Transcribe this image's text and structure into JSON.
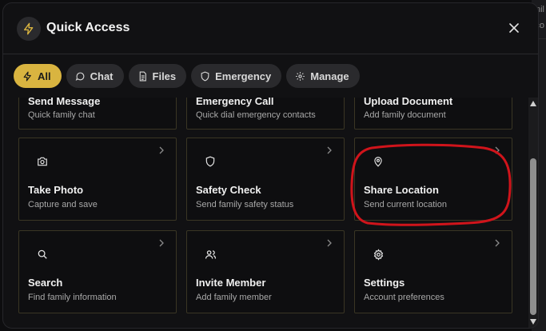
{
  "header": {
    "title": "Quick Access",
    "close_label": "×"
  },
  "tabs": [
    {
      "label": "All",
      "icon": "lightning-icon",
      "active": true
    },
    {
      "label": "Chat",
      "icon": "chat-bubble-icon",
      "active": false
    },
    {
      "label": "Files",
      "icon": "document-icon",
      "active": false
    },
    {
      "label": "Emergency",
      "icon": "shield-icon",
      "active": false
    },
    {
      "label": "Manage",
      "icon": "gear-icon",
      "active": false
    }
  ],
  "cards": [
    {
      "title": "Send Message",
      "subtitle": "Quick family chat",
      "icon": "chat-icon"
    },
    {
      "title": "Emergency Call",
      "subtitle": "Quick dial emergency contacts",
      "icon": "phone-icon"
    },
    {
      "title": "Upload Document",
      "subtitle": "Add family document",
      "icon": "upload-icon"
    },
    {
      "title": "Take Photo",
      "subtitle": "Capture and save",
      "icon": "camera-icon"
    },
    {
      "title": "Safety Check",
      "subtitle": "Send family safety status",
      "icon": "shield-icon"
    },
    {
      "title": "Share Location",
      "subtitle": "Send current location",
      "icon": "location-pin-icon"
    },
    {
      "title": "Search",
      "subtitle": "Find family information",
      "icon": "search-icon"
    },
    {
      "title": "Invite Member",
      "subtitle": "Add family member",
      "icon": "users-icon"
    },
    {
      "title": "Settings",
      "subtitle": "Account preferences",
      "icon": "gear-icon"
    }
  ],
  "background": {
    "fragments": [
      "nil",
      "co"
    ]
  },
  "colors": {
    "accent": "#d9b440",
    "annotation": "#d0141b",
    "card_border": "#3a3624"
  }
}
